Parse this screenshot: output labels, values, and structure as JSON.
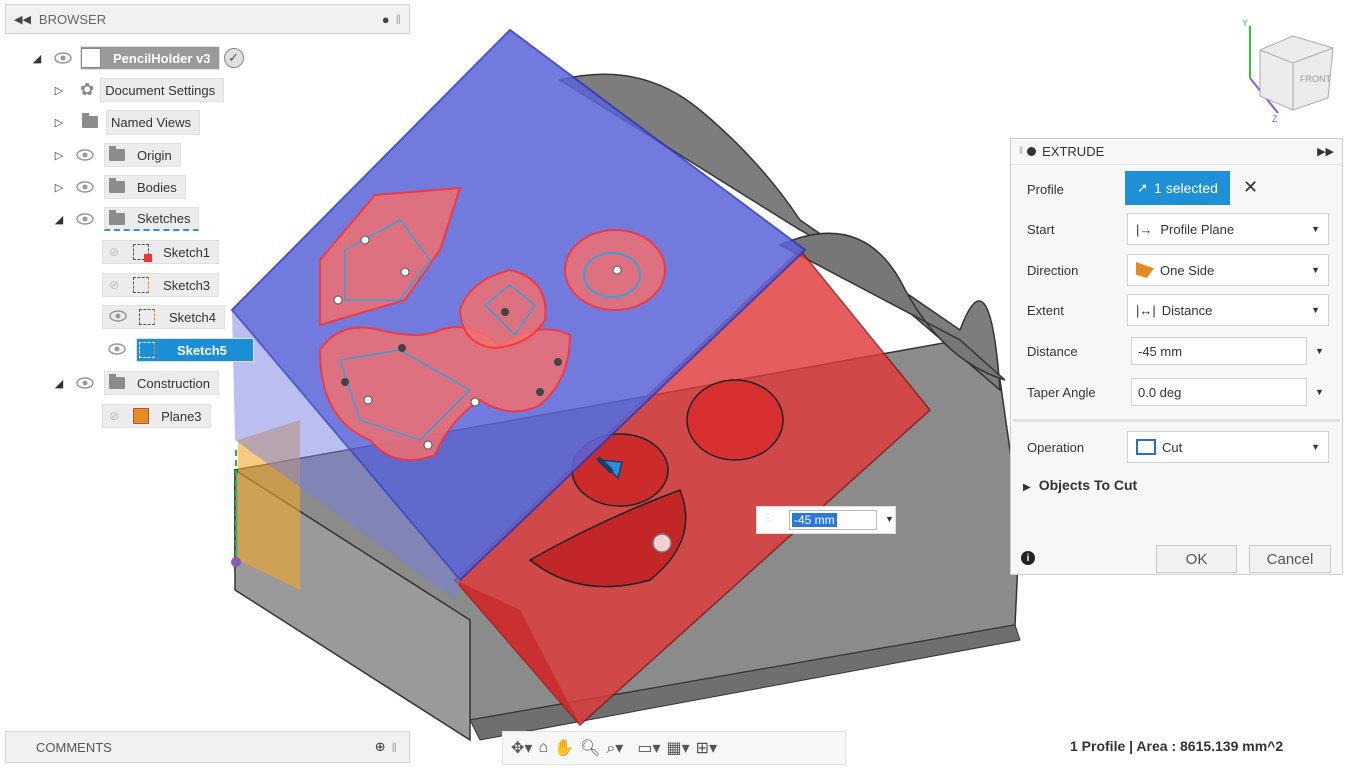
{
  "browser": {
    "title": "BROWSER",
    "tree": [
      {
        "label": "PencilHolder v3",
        "icon": "component-icon"
      },
      {
        "label": "Document Settings",
        "icon": "gear-icon"
      },
      {
        "label": "Named Views",
        "icon": "folder-icon"
      },
      {
        "label": "Origin",
        "icon": "folder-icon"
      },
      {
        "label": "Bodies",
        "icon": "folder-icon"
      },
      {
        "label": "Sketches",
        "icon": "folder-icon"
      },
      {
        "label": "Sketch1",
        "icon": "sketch-icon"
      },
      {
        "label": "Sketch3",
        "icon": "sketch-icon"
      },
      {
        "label": "Sketch4",
        "icon": "sketch-icon"
      },
      {
        "label": "Sketch5",
        "icon": "sketch-icon"
      },
      {
        "label": "Construction",
        "icon": "folder-icon"
      },
      {
        "label": "Plane3",
        "icon": "plane-icon"
      }
    ]
  },
  "comments": {
    "title": "COMMENTS"
  },
  "viewcube": {
    "face_label": "FRONT",
    "axis_y": "Y",
    "axis_z": "Z"
  },
  "extrude": {
    "title": "EXTRUDE",
    "profile_label": "Profile",
    "profile_value": "1 selected",
    "start_label": "Start",
    "start_value": "Profile Plane",
    "direction_label": "Direction",
    "direction_value": "One Side",
    "extent_label": "Extent",
    "extent_value": "Distance",
    "distance_label": "Distance",
    "distance_value": "-45 mm",
    "taper_label": "Taper Angle",
    "taper_value": "0.0 deg",
    "operation_label": "Operation",
    "operation_value": "Cut",
    "objects_to_cut": "Objects To Cut",
    "ok": "OK",
    "cancel": "Cancel"
  },
  "canvas_input": {
    "value": "-45 mm"
  },
  "status": {
    "text": "1 Profile | Area : 8615.139 mm^2"
  },
  "colors": {
    "accent": "#1f8fd6",
    "body_blue": "#5a64d8",
    "body_red": "#e13a3a",
    "model_gray": "#8a8a8a"
  }
}
